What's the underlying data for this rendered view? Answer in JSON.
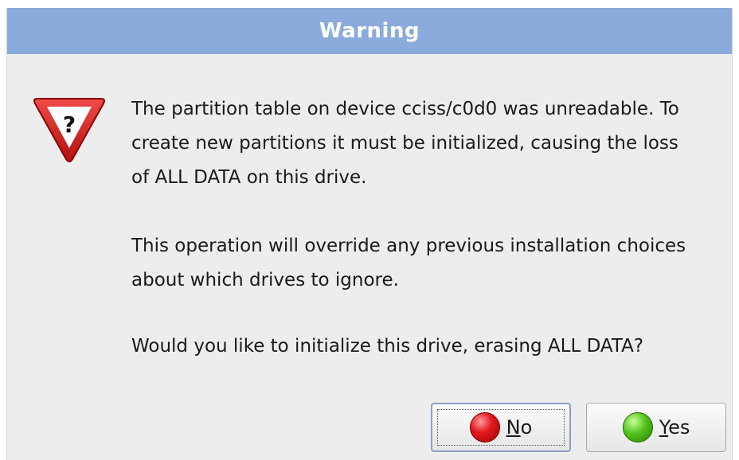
{
  "window": {
    "title": "Warning"
  },
  "dialog": {
    "icon": "warning-question-icon",
    "paragraphs": [
      "The partition table on device cciss/c0d0 was unreadable. To create new partitions it must be initialized, causing the loss of ALL DATA on this drive.",
      "This operation will override any previous installation choices about which drives to ignore.",
      "Would you like to initialize this drive, erasing ALL DATA?"
    ],
    "lines": [
      "The partition table on device cciss/c0d0 was unreadable. To",
      "create new partitions it must be initialized, causing the loss",
      "of ALL DATA on this drive.",
      "This operation will override any previous installation choices",
      "about which drives to ignore.",
      "Would you like to initialize this drive, erasing ALL DATA?"
    ]
  },
  "buttons": {
    "no": {
      "mnemonic": "N",
      "rest": "o",
      "icon": "red-circle-icon",
      "color": "#e3191f"
    },
    "yes": {
      "mnemonic": "Y",
      "rest": "es",
      "icon": "green-circle-icon",
      "color": "#52c21c"
    }
  },
  "colors": {
    "titlebar": "#8aabdc",
    "background": "#ededed"
  }
}
